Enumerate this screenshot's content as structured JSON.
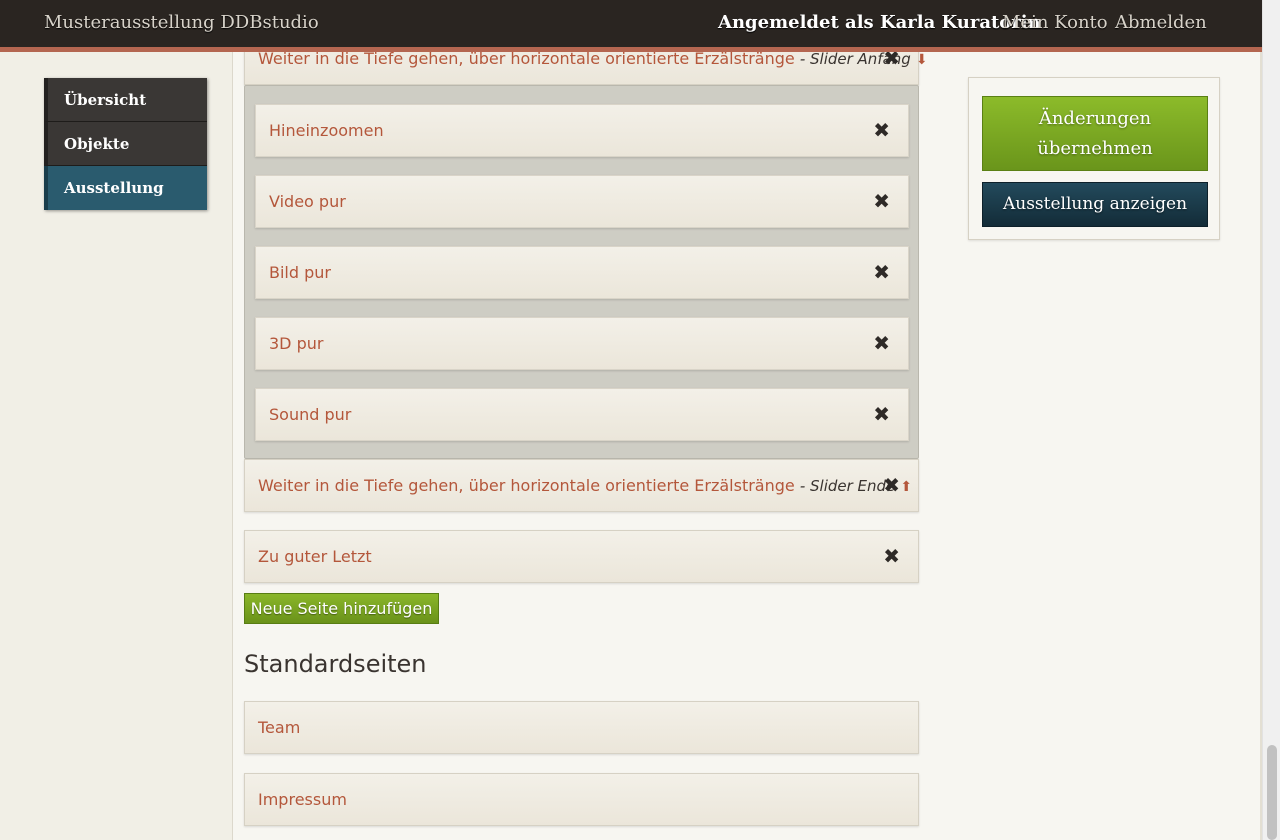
{
  "header": {
    "site_title": "Musterausstellung DDBstudio",
    "user_status": "Angemeldet als Karla Kuratorin",
    "account_link": "Mein Konto",
    "logout_link": "Abmelden"
  },
  "sidebar": {
    "items": [
      {
        "label": "Übersicht",
        "active": false
      },
      {
        "label": "Objekte",
        "active": false
      },
      {
        "label": "Ausstellung",
        "active": true
      }
    ]
  },
  "pages": {
    "slider_start": {
      "label": "Weiter in die Tiefe gehen, über horizontale orientierte Erzälstränge",
      "suffix": "- Slider Anfang",
      "arrow": "⬇"
    },
    "slider_children": [
      {
        "label": "Hineinzoomen"
      },
      {
        "label": "Video pur"
      },
      {
        "label": "Bild pur"
      },
      {
        "label": "3D pur"
      },
      {
        "label": "Sound pur"
      }
    ],
    "slider_end": {
      "label": "Weiter in die Tiefe gehen, über horizontale orientierte Erzälstränge",
      "suffix": "- Slider Ende",
      "arrow": "⬆"
    },
    "last": {
      "label": "Zu guter Letzt"
    },
    "remove_icon": "✖",
    "add_button": "Neue Seite hinzufügen"
  },
  "standard_pages": {
    "heading": "Standardseiten",
    "items": [
      {
        "label": "Team"
      },
      {
        "label": "Impressum"
      }
    ]
  },
  "actions": {
    "apply_label": "Änderungen übernehmen",
    "show_label": "Ausstellung anzeigen"
  },
  "colors": {
    "accent_text": "#b4573b",
    "topbar": "#2a2521",
    "stripe": "#b46650",
    "active_nav": "#2a5b6e",
    "apply_green": "#7aa622",
    "show_blue": "#1b3a49"
  }
}
